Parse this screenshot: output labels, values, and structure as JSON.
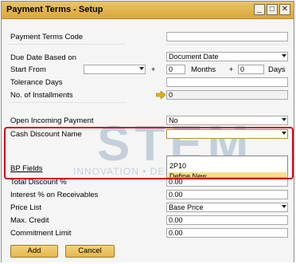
{
  "window": {
    "title": "Payment Terms - Setup",
    "min_glyph": "_",
    "max_glyph": "□",
    "close_glyph": "✕"
  },
  "form": {
    "payment_terms_code": {
      "label": "Payment Terms Code",
      "value": ""
    },
    "due_date_based_on": {
      "label": "Due Date Based on",
      "value": "Document Date"
    },
    "start_from": {
      "label": "Start From",
      "value": "",
      "plus": "+",
      "months_value": "0",
      "months_label": "Months",
      "plus2": "+",
      "days_value": "0",
      "days_label": "Days"
    },
    "tolerance_days": {
      "label": "Tolerance Days",
      "value": ""
    },
    "no_of_installments": {
      "label": "No. of Installments",
      "value": "0"
    },
    "open_incoming_payment": {
      "label": "Open Incoming Payment",
      "value": "No"
    },
    "cash_discount_name": {
      "label": "Cash Discount Name",
      "value": ""
    },
    "bp_fields": {
      "label": "BP Fields"
    },
    "total_discount": {
      "label": "Total Discount %",
      "value": "0.00"
    },
    "interest_receivables": {
      "label": "Interest % on Receivables",
      "value": "0.00"
    },
    "price_list": {
      "label": "Price List",
      "value": "Base Price"
    },
    "max_credit": {
      "label": "Max. Credit",
      "value": "0.00"
    },
    "commitment_limit": {
      "label": "Commitment Limit",
      "value": "0.00"
    }
  },
  "dropdown": {
    "options": [
      "2P10",
      "Define New"
    ],
    "selected_index": 1
  },
  "buttons": {
    "add": "Add",
    "cancel": "Cancel"
  },
  "watermark": {
    "brand": "STEM",
    "tagline": "INNOVATION • DESIGN • VALUE",
    "registered": "®"
  },
  "colors": {
    "titlebar": "#e2b24d",
    "highlight": "#c8101e",
    "selected_option": "#f5e08a",
    "arrow_icon": "#e5b100"
  }
}
